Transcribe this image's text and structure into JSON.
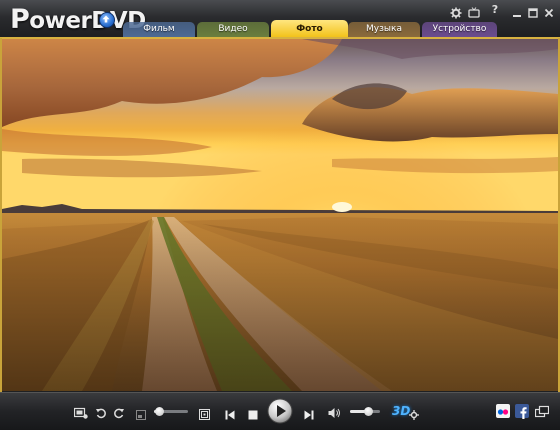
{
  "app": {
    "logo_prefix": "P",
    "logo_rest": "owerDVD",
    "upgrade_icon": "upgrade-arrow-icon"
  },
  "tabs": [
    {
      "label": "Фильм",
      "color": "#4d6a94",
      "active": false
    },
    {
      "label": "Видео",
      "color": "#6a7e3e",
      "active": false
    },
    {
      "label": "Фото",
      "color": "#f2c21a",
      "active": true
    },
    {
      "label": "Музыка",
      "color": "#8a6a3c",
      "active": false
    },
    {
      "label": "Устройство",
      "color": "#6a4c8e",
      "active": false
    }
  ],
  "window_controls": [
    "settings-gear-icon",
    "tv-mode-icon",
    "help-icon",
    "minimize-icon",
    "maximize-icon",
    "close-icon"
  ],
  "window_labels": {
    "help": "?"
  },
  "controls": {
    "icons": [
      "slideshow-settings-icon",
      "rotate-left-icon",
      "rotate-right-icon",
      "zoom-out-icon",
      "zoom-in-icon",
      "previous-icon",
      "stop-icon",
      "play-icon",
      "next-icon",
      "volume-icon",
      "3d-settings-icon",
      "flickr-icon",
      "facebook-icon",
      "display-mode-icon"
    ],
    "zoom_level": 0.15,
    "volume_level": 0.6,
    "three_d_label": "3D"
  },
  "colors": {
    "frame_gold": "#d8b240",
    "flickr_blue": "#0063dc",
    "flickr_pink": "#ff0084",
    "facebook_blue": "#3b5998"
  }
}
